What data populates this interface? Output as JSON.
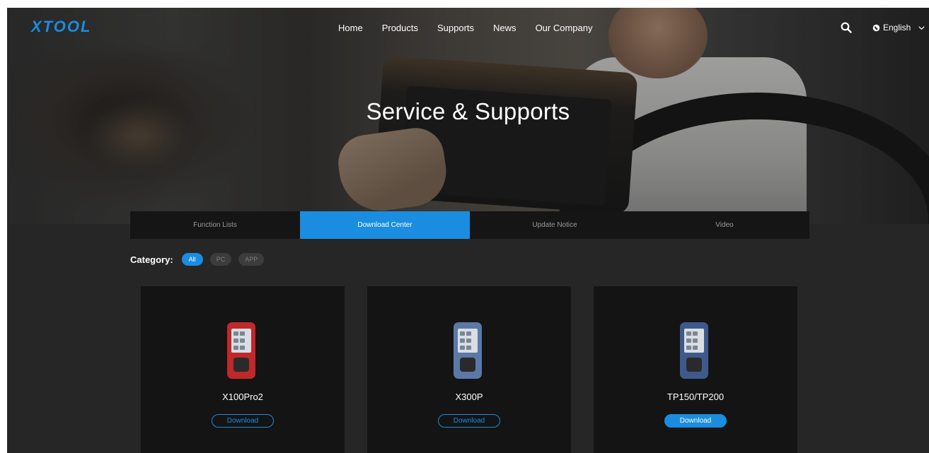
{
  "header": {
    "logo_text": "XTOOL",
    "nav": [
      "Home",
      "Products",
      "Supports",
      "News",
      "Our Company"
    ],
    "language": "English",
    "icons": [
      "search-icon",
      "globe-icon",
      "chevron-down-icon"
    ]
  },
  "hero": {
    "title": "Service & Supports"
  },
  "tabs": [
    {
      "label": "Function Lists",
      "active": false
    },
    {
      "label": "Download Center",
      "active": true
    },
    {
      "label": "Update Notice",
      "active": false
    },
    {
      "label": "Video",
      "active": false
    }
  ],
  "category": {
    "label": "Category:",
    "options": [
      {
        "label": "All",
        "active": true
      },
      {
        "label": "PC",
        "active": false
      },
      {
        "label": "APP",
        "active": false
      }
    ]
  },
  "products": [
    {
      "name": "X100Pro2",
      "button": "Download",
      "device_color": "#c0282a",
      "button_filled": false
    },
    {
      "name": "X300P",
      "button": "Download",
      "device_color": "#5b78a6",
      "button_filled": false
    },
    {
      "name": "TP150/TP200",
      "button": "Download",
      "device_color": "#3e5a8c",
      "button_filled": true
    }
  ],
  "colors": {
    "accent": "#1a8de0",
    "background": "#262626",
    "card": "#141414"
  }
}
